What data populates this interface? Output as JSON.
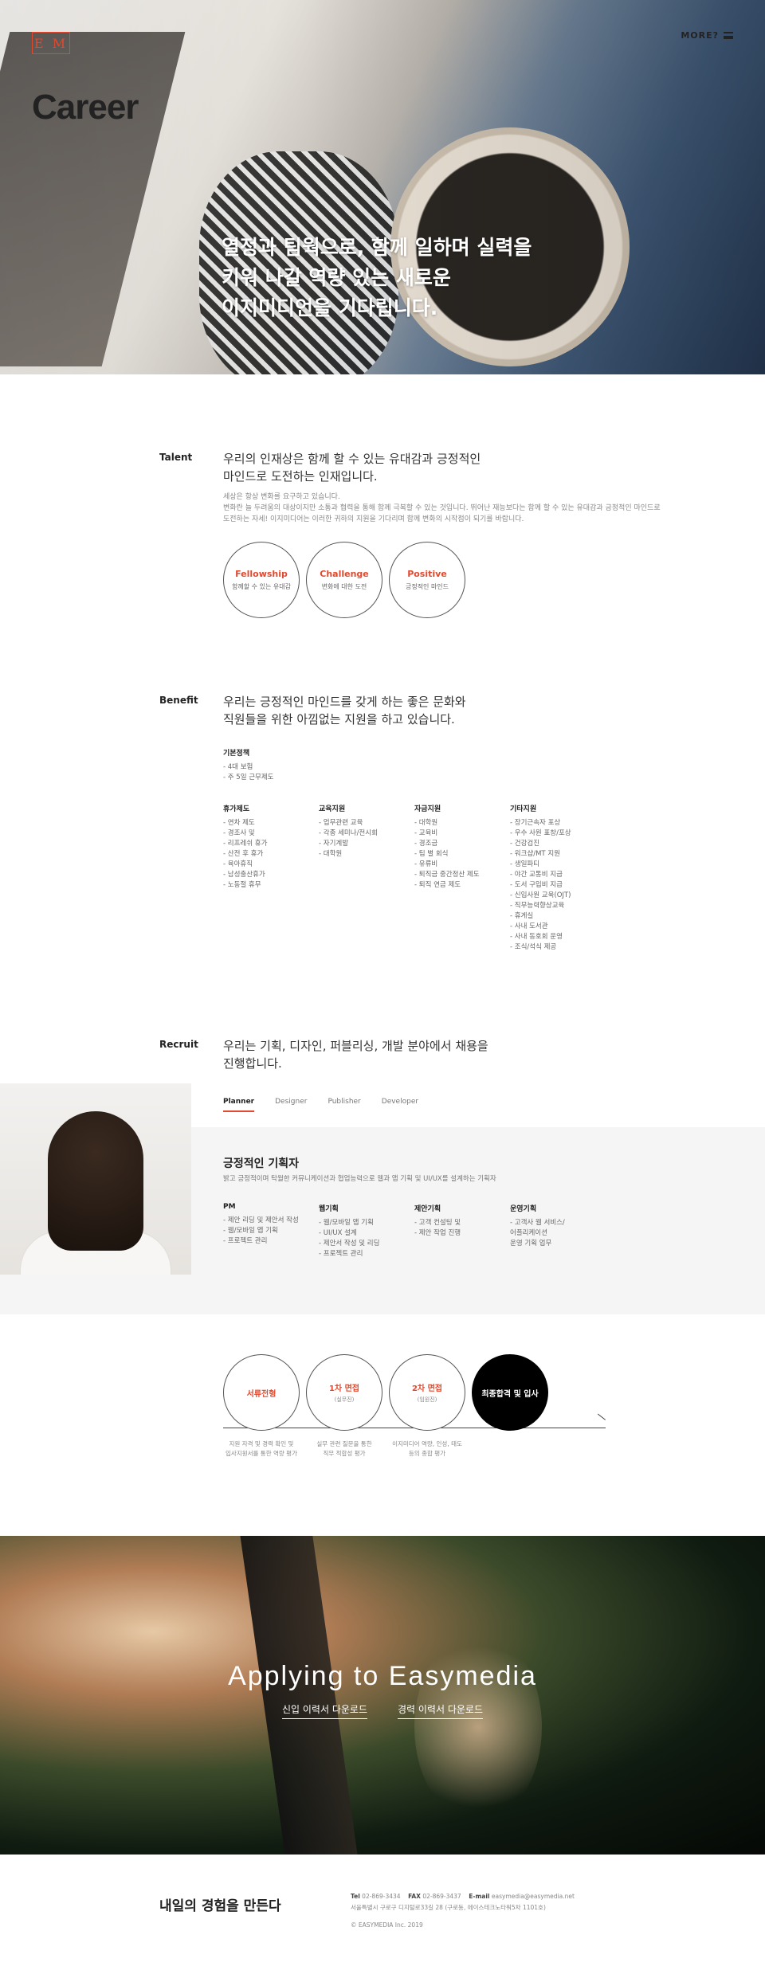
{
  "header": {
    "logo_text": "E M",
    "menu_label": "MORE?"
  },
  "hero": {
    "title": "Career",
    "copy": "열정과 팀웍으로, 함께 일하며 실력을\n키워 나갈 역량 있는 새로운\n이지미디언을 기다립니다."
  },
  "talent": {
    "label": "Talent",
    "lead": "우리의 인재상은 함께 할 수 있는 유대감과 긍정적인\n마인드로 도전하는 인재입니다.",
    "desc1": "세상은 항상 변화를 요구하고 있습니다.",
    "desc2": "변화란 늘 두려움의 대상이지만 소통과 협력을 통해 함께 극복할 수 있는 것입니다. 뛰어난 재능보다는 함께 할 수 있는 유대감과 긍정적인 마인드로",
    "desc3": "도전하는 자세! 이지미디어는 이러한 귀하의 지원을 기다리며 함께 변화의 시작점이 되기를 바랍니다.",
    "values": [
      {
        "title": "Fellowship",
        "sub": "함께할 수 있는 유대감"
      },
      {
        "title": "Challenge",
        "sub": "변화에 대한 도전"
      },
      {
        "title": "Positive",
        "sub": "긍정적인 마인드"
      }
    ]
  },
  "benefit": {
    "label": "Benefit",
    "lead": "우리는 긍정적인 마인드를 갖게 하는 좋은 문화와\n직원들을 위한 아낌없는 지원을 하고 있습니다.",
    "basic": {
      "title": "기본정책",
      "items": [
        "- 4대 보험",
        "- 주 5일 근무제도"
      ]
    },
    "columns": [
      {
        "title": "휴가제도",
        "items": [
          "- 연차 제도",
          "- 경조사 및",
          "- 리프레쉬 휴가",
          "- 산전 후 휴가",
          "- 육아휴직",
          "- 남성출산휴가",
          "- 노동절 휴무"
        ]
      },
      {
        "title": "교육지원",
        "items": [
          "- 업무관련 교육",
          "- 각종 세미나/전시회",
          "- 자기계발",
          "- 대학원"
        ]
      },
      {
        "title": "자금지원",
        "items": [
          "- 대학원",
          "- 교육비",
          "- 경조금",
          "- 팀 별 회식",
          "- 유류비",
          "- 퇴직금 중간정산 제도",
          "- 퇴직 연금 제도"
        ]
      },
      {
        "title": "기타지원",
        "items": [
          "- 장기근속자 포상",
          "- 우수 사원 표창/포상",
          "- 건강검진",
          "- 워크샵/MT 지원",
          "- 생일파티",
          "- 야간 교통비 지급",
          "- 도서 구입비 지급",
          "- 신입사원 교육(OJT)",
          "- 직무능력향상교육",
          "- 휴게실",
          "- 사내 도서관",
          "- 사내 동호회 운영",
          "- 조식/석식 제공"
        ]
      }
    ]
  },
  "recruit": {
    "label": "Recruit",
    "lead": "우리는 기획, 디자인, 퍼블리싱, 개발 분야에서 채용을\n진행합니다.",
    "tabs": [
      "Planner",
      "Designer",
      "Publisher",
      "Developer"
    ],
    "active_tab": "Planner",
    "job_title": "긍정적인 기획자",
    "job_desc": "밝고 긍정적이며 탁월한 커뮤니케이션과 협업능력으로 웹과 앱 기획 및 UI/UX를 설계하는 기획자",
    "columns": [
      {
        "title": "PM",
        "items": [
          "- 제안 리딩 및 제안서 작성",
          "- 웹/모바일 앱 기획",
          "- 프로젝트 관리"
        ]
      },
      {
        "title": "웹기획",
        "items": [
          "- 웹/모바일 앱 기획",
          "- UI/UX 설계",
          "- 제안서 작성 및 리딩",
          "- 프로젝트 관리"
        ]
      },
      {
        "title": "제안기획",
        "items": [
          "- 고객 컨설팅 및",
          "- 제안 작업 진행"
        ]
      },
      {
        "title": "운영기획",
        "items": [
          "- 고객사 웹 서비스/\n  어플리케이션\n  운영 기획 업무"
        ]
      }
    ]
  },
  "process": {
    "steps": [
      {
        "title": "서류전형",
        "sub": "",
        "desc": "지원 자격 및 경력 확인 및\n입사지원서를 통한 역량 평가"
      },
      {
        "title": "1차 면접",
        "sub": "(실무진)",
        "desc": "실무 관련 질문을 통한\n직무 적합성 평가"
      },
      {
        "title": "2차 면접",
        "sub": "(임원진)",
        "desc": "이지미디어 역량, 인성, 태도\n등의 종합 평가"
      },
      {
        "title": "최종합격 및 입사",
        "sub": "",
        "desc": ""
      }
    ]
  },
  "apply": {
    "title": "Applying to Easymedia",
    "links": [
      "신입 이력서 다운로드",
      "경력 이력서 다운로드"
    ]
  },
  "footer": {
    "title": "내일의 경험을 만든다",
    "tel_label": "Tel",
    "tel": "02-869-3434",
    "fax_label": "FAX",
    "fax": "02-869-3437",
    "email_label": "E-mail",
    "email": "easymedia@easymedia.net",
    "address": "서울특별시 구로구 디지털로33길 28 (구로동, 에이스테크노타워5차 1101호)",
    "copyright": "© EASYMEDIA Inc. 2019"
  }
}
